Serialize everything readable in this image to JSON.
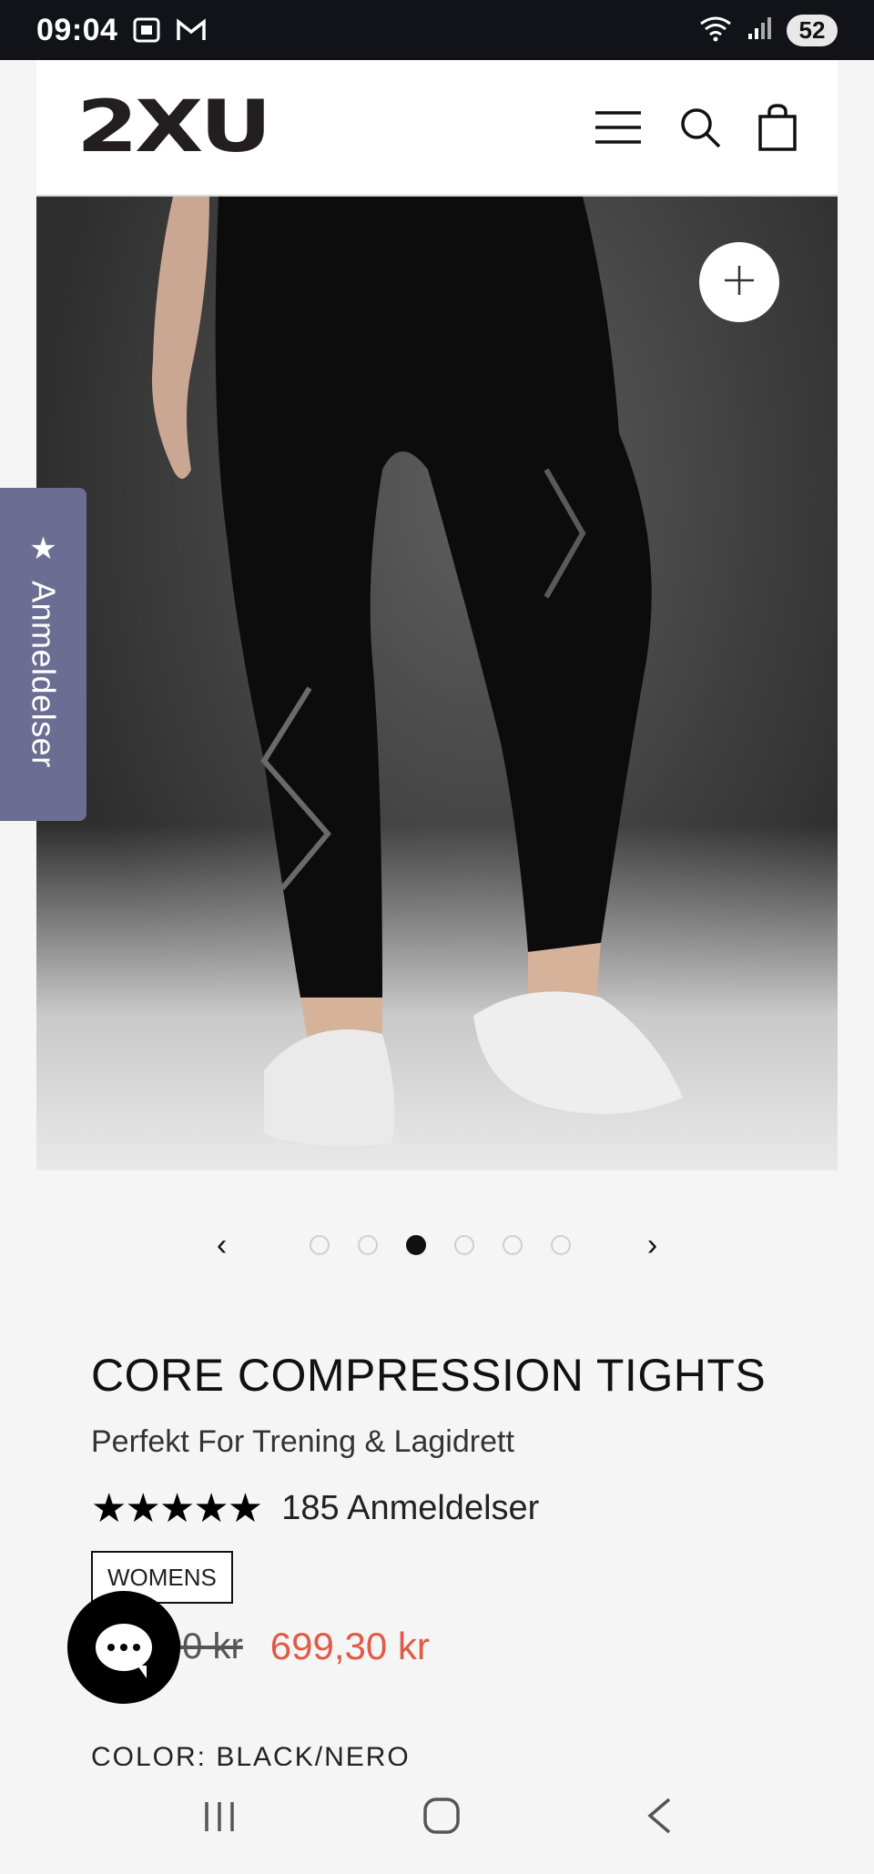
{
  "status_bar": {
    "time": "09:04",
    "battery": "52",
    "icons": [
      "screenshot-icon",
      "gmail-icon",
      "wifi-icon",
      "signal-icon"
    ]
  },
  "header": {
    "logo": "2XU",
    "icons": [
      "menu-icon",
      "search-icon",
      "cart-icon"
    ]
  },
  "gallery": {
    "zoom_icon": "plus-icon",
    "prev": "‹",
    "next": "›",
    "dots": [
      false,
      false,
      true,
      false,
      false,
      false
    ]
  },
  "reviews_tab": {
    "icon": "★",
    "label": "Anmeldelser"
  },
  "product": {
    "title": "CORE COMPRESSION TIGHTS",
    "subtitle": "Perfekt For Trening & Lagidrett",
    "rating": 5,
    "stars": "★★★★★",
    "review_count": "185 Anmeldelser",
    "tag": "WOMENS",
    "old_price": "999,00 kr",
    "sale_price": "699,30 kr",
    "color_label": "COLOR: BLACK/NERO"
  },
  "colors": {
    "sale": "#e05a47",
    "reviews_tab": "#6b6d93",
    "status_bar": "#111318"
  },
  "navbar": {
    "recents": "|||",
    "home": "▢",
    "back": "‹"
  }
}
